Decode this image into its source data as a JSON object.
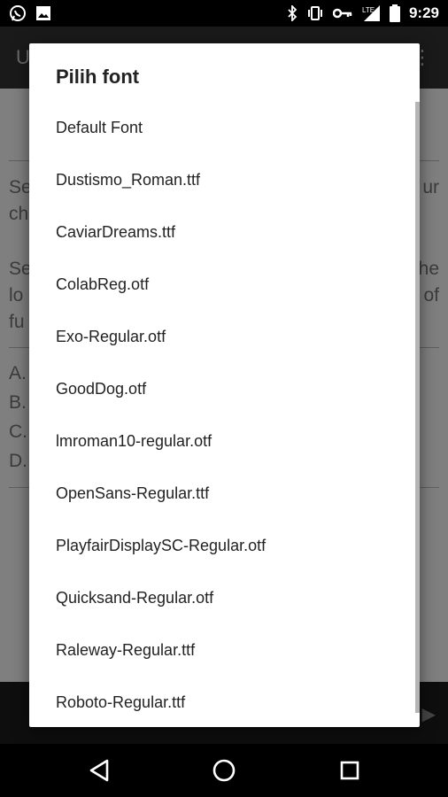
{
  "status_bar": {
    "time": "9:29",
    "left_icons": [
      "whatsapp-icon",
      "image-icon"
    ],
    "right_icons": [
      "bluetooth-icon",
      "vibrate-icon",
      "key-icon",
      "lte-signal-icon",
      "battery-icon"
    ],
    "network": "LTE"
  },
  "app": {
    "toolbar_title": "U",
    "lines": [
      "Se",
      "ch",
      "Se",
      "lo",
      "fu",
      "A.",
      "B.",
      "C.",
      "D."
    ],
    "right_lines": [
      "ur",
      "he",
      "of"
    ]
  },
  "dialog": {
    "title": "Pilih font",
    "fonts": [
      "Default Font",
      "Dustismo_Roman.ttf",
      "CaviarDreams.ttf",
      "ColabReg.otf",
      "Exo-Regular.otf",
      "GoodDog.otf",
      "lmroman10-regular.otf",
      "OpenSans-Regular.ttf",
      "PlayfairDisplaySC-Regular.otf",
      "Quicksand-Regular.otf",
      "Raleway-Regular.ttf",
      "Roboto-Regular.ttf"
    ]
  },
  "nav": {
    "icons": [
      "back-icon",
      "home-icon",
      "recents-icon"
    ]
  },
  "colors": {
    "dialog_bg": "#ffffff",
    "scrim": "#7f7f7f",
    "system_bar": "#000000"
  }
}
